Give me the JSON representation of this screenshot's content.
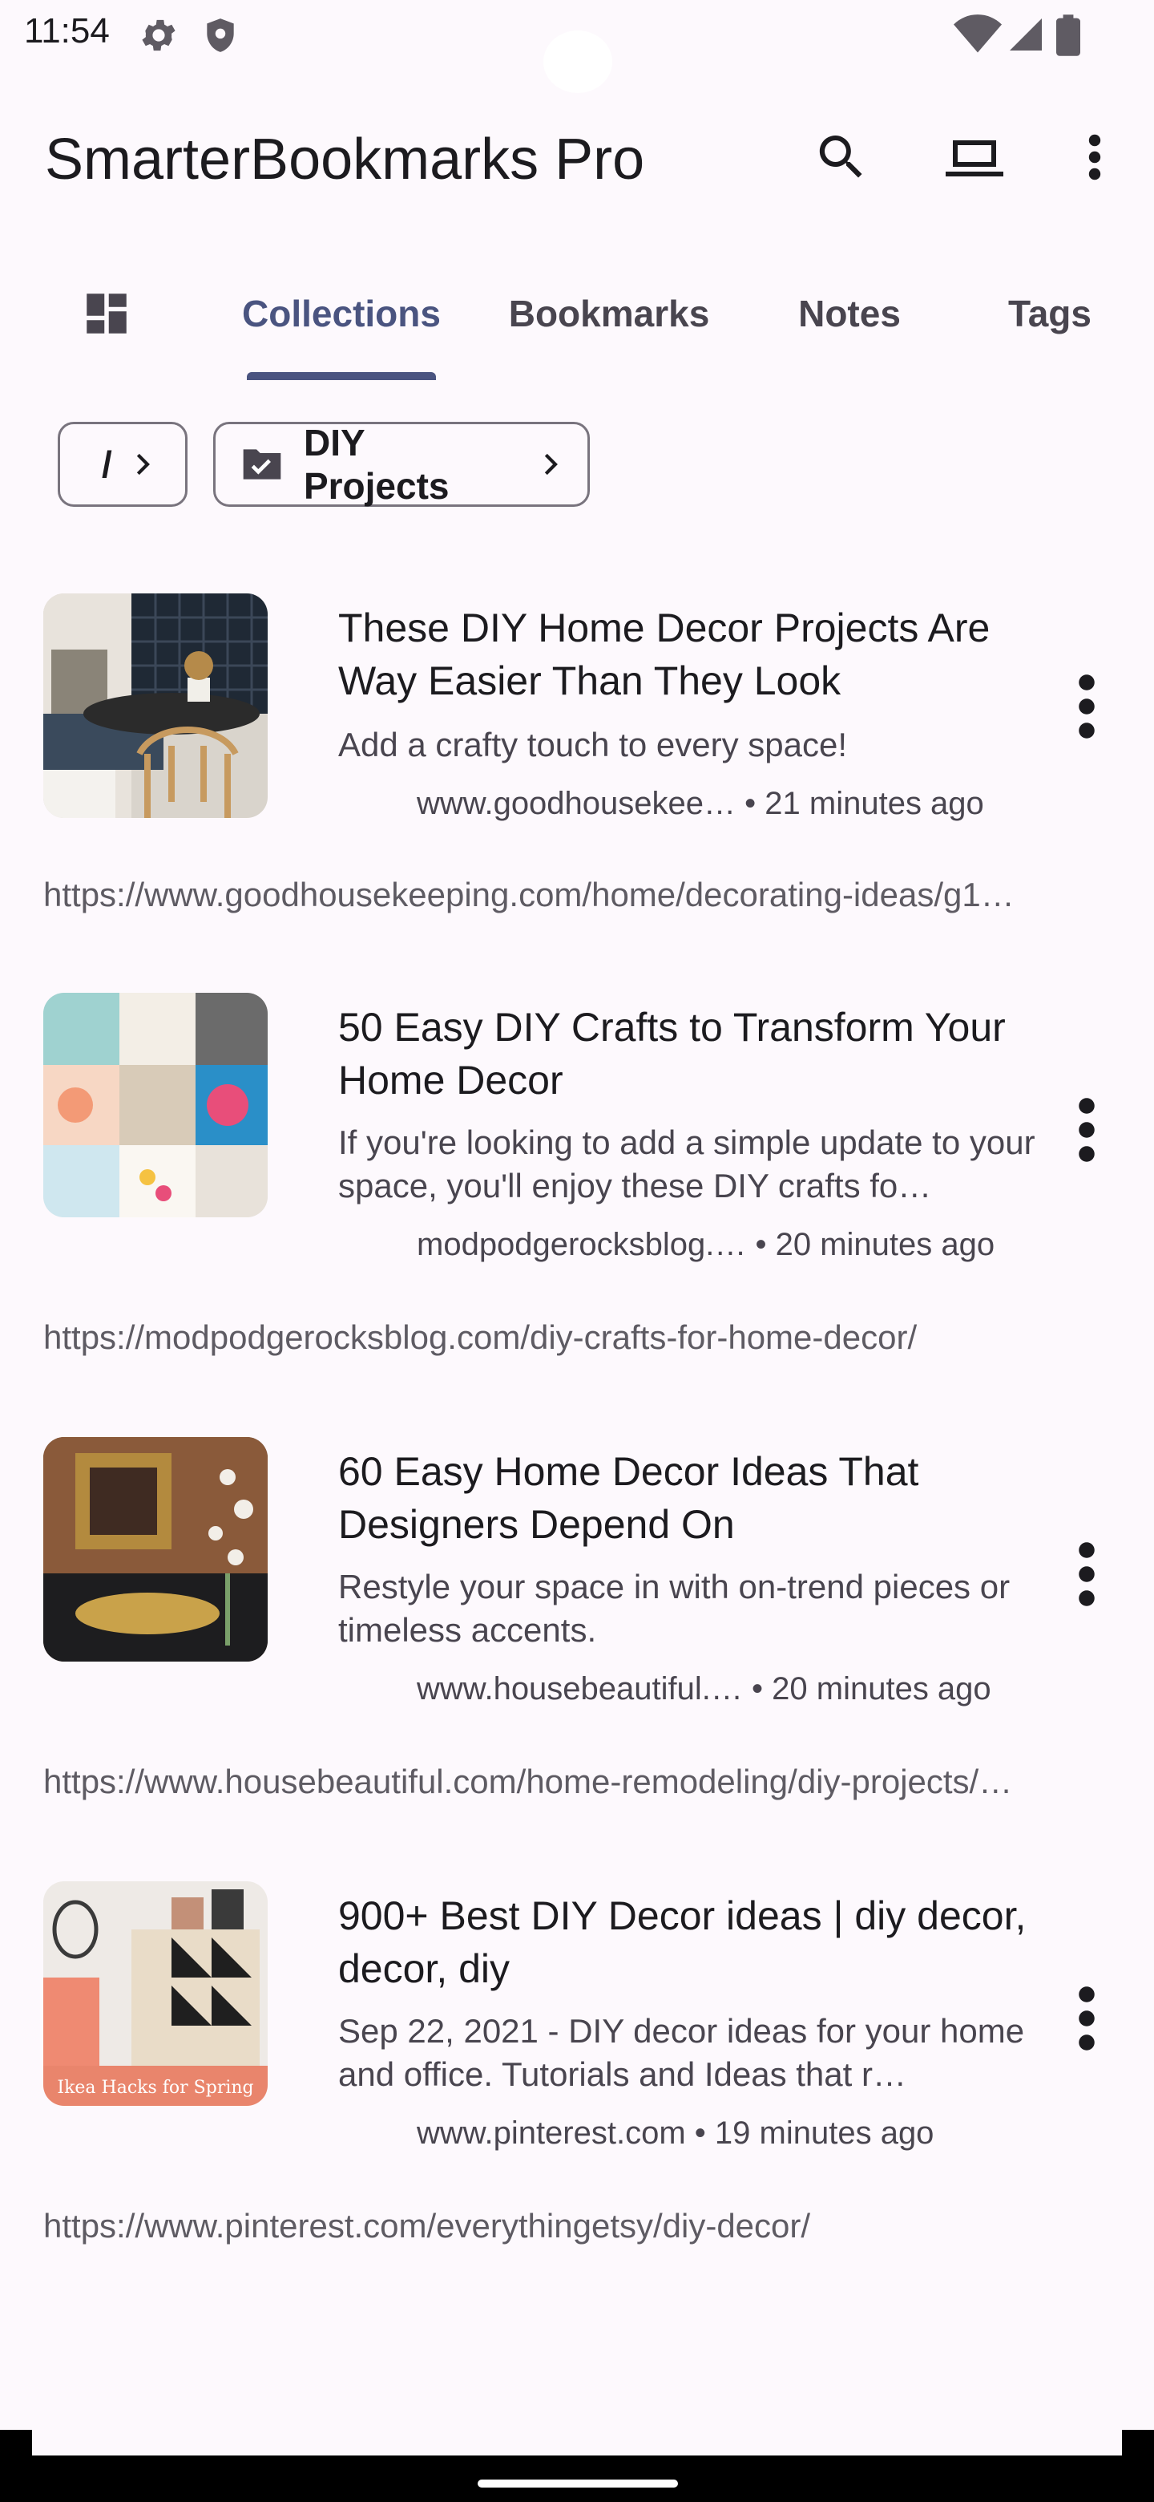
{
  "status": {
    "time": "11:54"
  },
  "app": {
    "title": "SmarterBookmarks Pro"
  },
  "tabs": [
    {
      "label": "Collections",
      "active": true
    },
    {
      "label": "Bookmarks",
      "active": false
    },
    {
      "label": "Notes",
      "active": false
    },
    {
      "label": "Tags",
      "active": false
    }
  ],
  "breadcrumb": {
    "root": "/",
    "current": "DIY Projects"
  },
  "bookmarks": [
    {
      "title": "These DIY Home Decor Projects Are Way Easier Than They Look",
      "description": "Add a crafty touch to every space!",
      "domain": "www.goodhousekee…",
      "time": "• 21 minutes ago",
      "url": "https://www.goodhousekeeping.com/home/decorating-ideas/g1…"
    },
    {
      "title": "50 Easy DIY Crafts to Transform Your Home Decor",
      "description": "If you're looking to add a simple update to your space, you'll enjoy these DIY crafts fo…",
      "domain": "modpodgerocksblog.…",
      "time": "• 20 minutes ago",
      "url": "https://modpodgerocksblog.com/diy-crafts-for-home-decor/"
    },
    {
      "title": "60 Easy Home Decor Ideas That Designers Depend On",
      "description": "Restyle your space in with on-trend pieces or timeless accents.",
      "domain": "www.housebeautiful.…",
      "time": "• 20 minutes ago",
      "url": "https://www.housebeautiful.com/home-remodeling/diy-projects/…"
    },
    {
      "title": "900+ Best DIY Decor ideas | diy decor, decor, diy",
      "description": "Sep 22, 2021 - DIY decor ideas for your home and office. Tutorials and Ideas that r…",
      "domain": "www.pinterest.com",
      "time": "• 19 minutes ago",
      "url": "https://www.pinterest.com/everythingetsy/diy-decor/",
      "thumb_caption": "Ikea Hacks for Spring"
    }
  ],
  "colors": {
    "accent": "#4a5480",
    "background": "#fdf9fd",
    "outline": "#79747e"
  }
}
